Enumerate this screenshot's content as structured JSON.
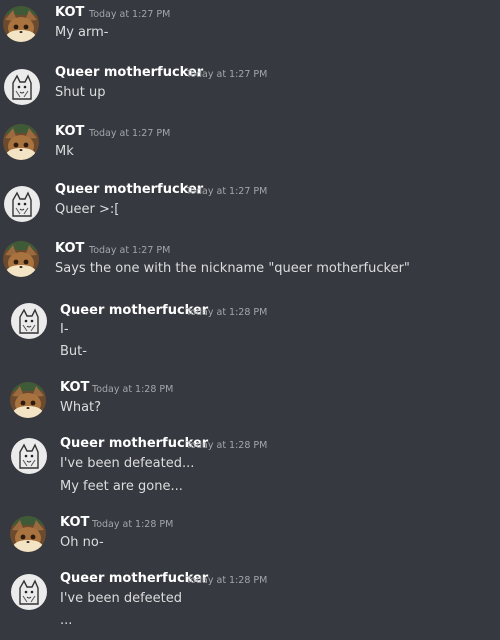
{
  "colors": {
    "background": "#36393f",
    "username": "#ffffff",
    "message_text": "#dcddde",
    "timestamp": "#a3a6aa"
  },
  "avatars": {
    "kot": "eevee-avatar-icon",
    "queer": "cat-sketch-avatar-icon"
  },
  "messages": [
    {
      "author": "KOT",
      "time": "Today at 1:27 PM",
      "lines": [
        "My arm-"
      ]
    },
    {
      "author": "Queer motherfucker",
      "time": "Today at 1:27 PM",
      "lines": [
        "Shut up"
      ]
    },
    {
      "author": "KOT",
      "time": "Today at 1:27 PM",
      "lines": [
        "Mk"
      ]
    },
    {
      "author": "Queer motherfucker",
      "time": "Today at 1:27 PM",
      "lines": [
        "Queer >:["
      ]
    },
    {
      "author": "KOT",
      "time": "Today at 1:27 PM",
      "lines": [
        "Says the one with the nickname \"queer motherfucker\""
      ]
    },
    {
      "author": "Queer motherfucker",
      "time": "Today at 1:28 PM",
      "lines": [
        "I-",
        "But-"
      ]
    },
    {
      "author": "KOT",
      "time": "Today at 1:28 PM",
      "lines": [
        "What?"
      ]
    },
    {
      "author": "Queer motherfucker",
      "time": "Today at 1:28 PM",
      "lines": [
        "I've been defeated...",
        "My feet are gone..."
      ]
    },
    {
      "author": "KOT",
      "time": "Today at 1:28 PM",
      "lines": [
        "Oh no-"
      ]
    },
    {
      "author": "Queer motherfucker",
      "time": "Today at 1:28 PM",
      "lines": [
        "I've been defeeted",
        "..."
      ]
    }
  ]
}
